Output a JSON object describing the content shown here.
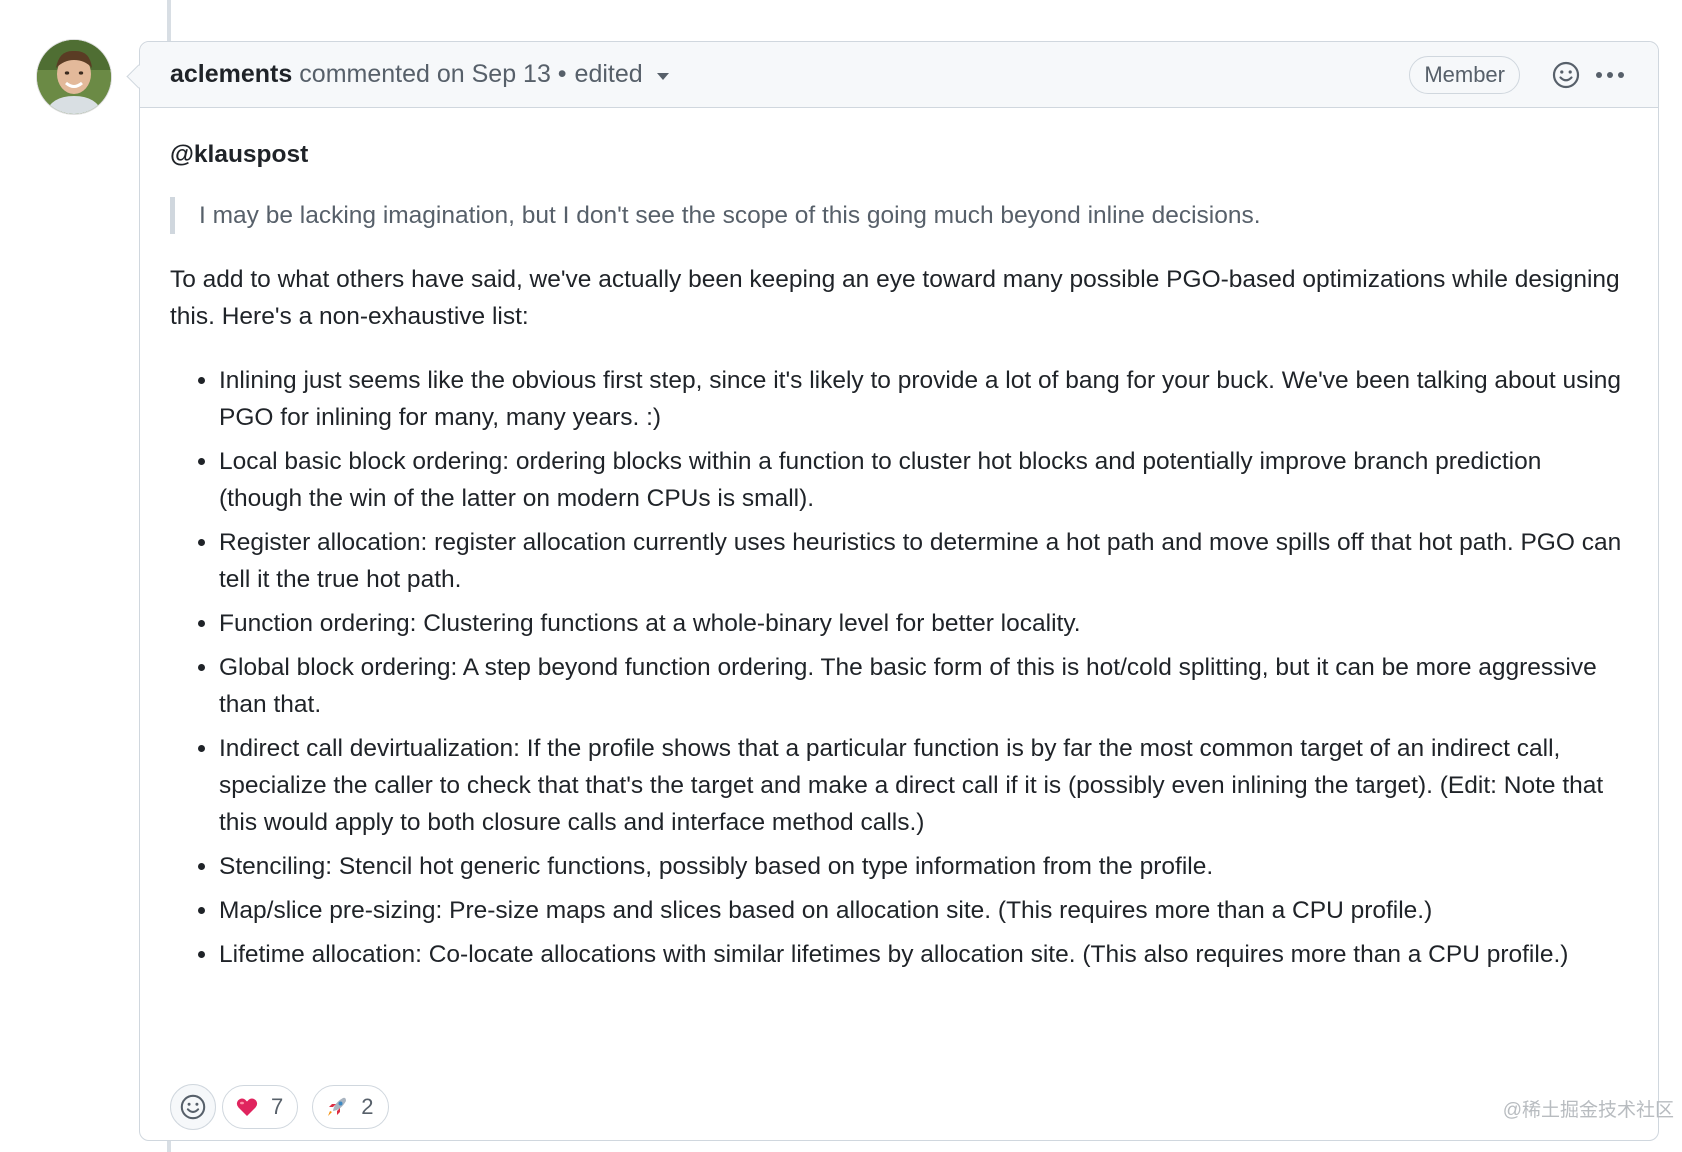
{
  "comment": {
    "author": "aclements",
    "header_text": "commented on Sep 13 •",
    "edited_label": "edited",
    "role_badge": "Member",
    "mention": "@klauspost",
    "quote": "I may be lacking imagination, but I don't see the scope of this going much beyond inline decisions.",
    "intro": "To add to what others have said, we've actually been keeping an eye toward many possible PGO-based optimizations while designing this. Here's a non-exhaustive list:",
    "items": [
      "Inlining just seems like the obvious first step, since it's likely to provide a lot of bang for your buck. We've been talking about using PGO for inlining for many, many years. :)",
      "Local basic block ordering: ordering blocks within a function to cluster hot blocks and potentially improve branch prediction (though the win of the latter on modern CPUs is small).",
      "Register allocation: register allocation currently uses heuristics to determine a hot path and move spills off that hot path. PGO can tell it the true hot path.",
      "Function ordering: Clustering functions at a whole-binary level for better locality.",
      "Global block ordering: A step beyond function ordering. The basic form of this is hot/cold splitting, but it can be more aggressive than that.",
      "Indirect call devirtualization: If the profile shows that a particular function is by far the most common target of an indirect call, specialize the caller to check that that's the target and make a direct call if it is (possibly even inlining the target). (Edit: Note that this would apply to both closure calls and interface method calls.)",
      "Stenciling: Stencil hot generic functions, possibly based on type information from the profile.",
      "Map/slice pre-sizing: Pre-size maps and slices based on allocation site. (This requires more than a CPU profile.)",
      "Lifetime allocation: Co-locate allocations with similar lifetimes by allocation site. (This also requires more than a CPU profile.)"
    ]
  },
  "reactions": [
    {
      "icon": "heart-icon",
      "count": "7"
    },
    {
      "icon": "rocket-icon",
      "count": "2"
    }
  ],
  "watermark": "@稀土掘金技术社区",
  "colors": {
    "border": "#d0d7de",
    "header_bg": "#f6f8fa",
    "muted": "#57606a",
    "text": "#1f2328"
  }
}
